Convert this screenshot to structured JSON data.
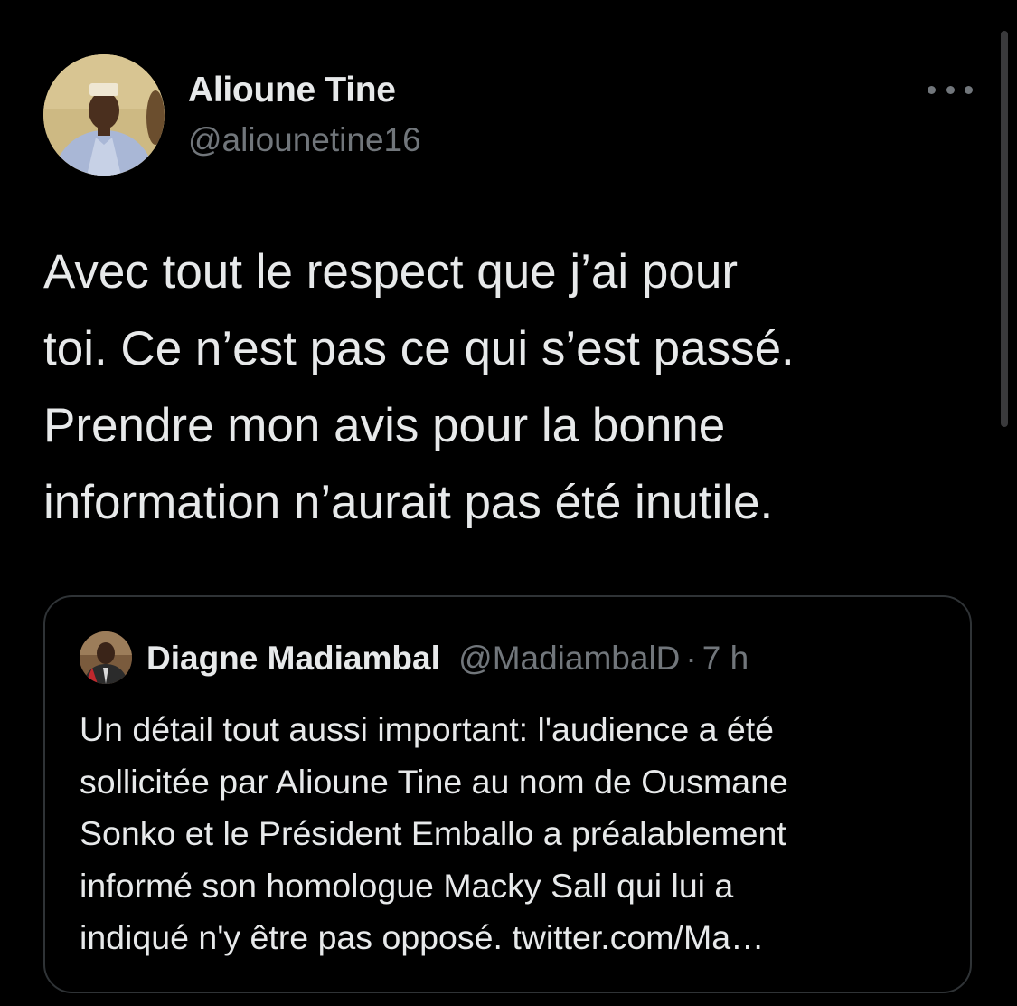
{
  "tweet": {
    "author": {
      "display_name": "Alioune Tine",
      "handle": "@aliounetine16",
      "avatar_icon": "profile-photo"
    },
    "more_icon": "more-horizontal-icon",
    "text_lines": [
      "Avec tout le respect que j’ai pour",
      "toi. Ce n’est pas ce qui s’est passé.",
      "Prendre mon avis pour la bonne",
      "information n’aurait pas été inutile."
    ]
  },
  "quoted_tweet": {
    "author": {
      "display_name": "Diagne Madiambal",
      "handle": "@MadiambalD",
      "separator": "·",
      "time": "7 h"
    },
    "text_lines": [
      "Un détail tout aussi important: l'audience a été",
      "sollicitée par Alioune Tine au nom de Ousmane",
      "Sonko et le Président Emballo a préalablement",
      "informé son homologue Macky Sall qui lui a",
      "indiqué n'y être pas opposé. twitter.com/Ma…"
    ]
  },
  "colors": {
    "background": "#000000",
    "primary_text": "#e7e9ea",
    "secondary_text": "#71767b",
    "border": "#2f3336"
  }
}
